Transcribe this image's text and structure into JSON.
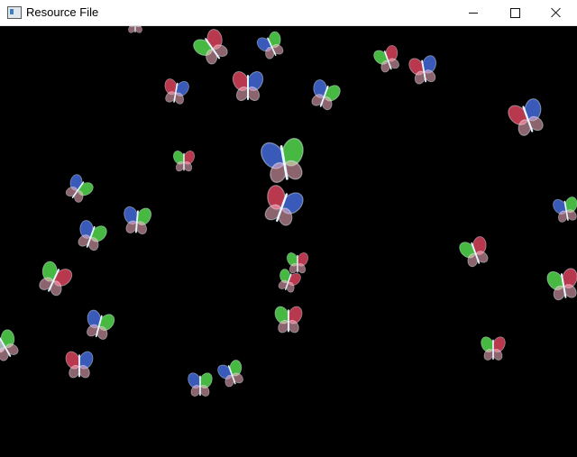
{
  "window": {
    "title": "Resource File",
    "icon": "window-app-icon",
    "controls": [
      "minimize",
      "maximize",
      "close"
    ]
  },
  "scene": {
    "background": "#000000",
    "sprite": "butterfly-icon",
    "palette": {
      "red": "#ff4d6b",
      "blue": "#4f7dff",
      "green": "#62ff5a",
      "pink": "#ffb6c8",
      "white": "#e8f6ff"
    }
  }
}
